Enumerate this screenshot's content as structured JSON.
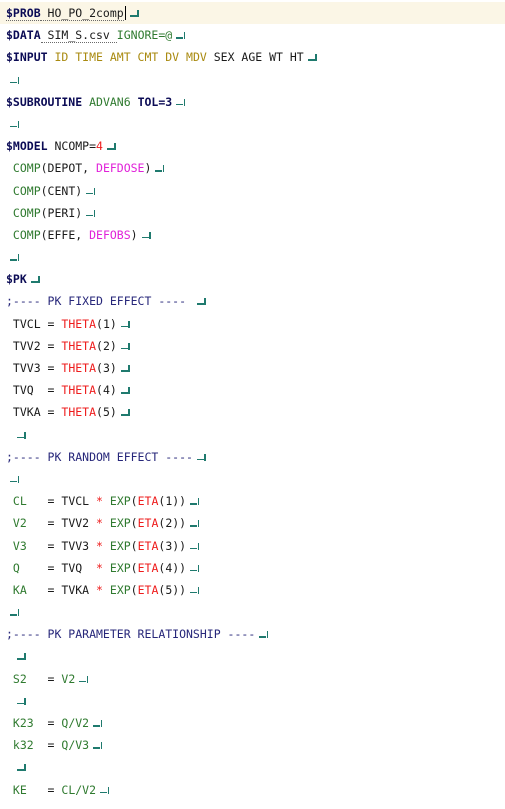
{
  "editor": {
    "lines": [
      [
        [
          "$PROB",
          "kw"
        ],
        [
          " HO_PO_2comp",
          "plain"
        ]
      ],
      [
        [
          "$DATA",
          "kw"
        ],
        [
          " SIM_S.csv ",
          "plain"
        ],
        [
          "IGNORE=@",
          "green"
        ]
      ],
      [
        [
          "$INPUT",
          "kw"
        ],
        [
          " ID TIME AMT CMT DV MDV",
          "olive"
        ],
        [
          " SEX AGE WT HT",
          "plain"
        ]
      ],
      [],
      [
        [
          "$SUBROUTINE",
          "kw"
        ],
        [
          " ADVAN6 ",
          "green"
        ],
        [
          "TOL=3",
          "kw"
        ]
      ],
      [],
      [
        [
          "$MODEL",
          "kw"
        ],
        [
          " NCOMP=",
          "plain"
        ],
        [
          "4",
          "red"
        ]
      ],
      [
        [
          " COMP",
          "green"
        ],
        [
          "(DEPOT, ",
          "plain"
        ],
        [
          "DEFDOSE",
          "mag"
        ],
        [
          ")",
          "plain"
        ]
      ],
      [
        [
          " COMP",
          "green"
        ],
        [
          "(CENT)",
          "plain"
        ]
      ],
      [
        [
          " COMP",
          "green"
        ],
        [
          "(PERI)",
          "plain"
        ]
      ],
      [
        [
          " COMP",
          "green"
        ],
        [
          "(EFFE, ",
          "plain"
        ],
        [
          "DEFOBS",
          "mag"
        ],
        [
          ")",
          "plain"
        ]
      ],
      [],
      [
        [
          "$PK",
          "kw"
        ]
      ],
      [
        [
          ";---- PK FIXED EFFECT ---- ",
          "cmt"
        ]
      ],
      [
        [
          " TVCL = ",
          "plain"
        ],
        [
          "THETA",
          "red"
        ],
        [
          "(1)",
          "plain"
        ]
      ],
      [
        [
          " TVV2 = ",
          "plain"
        ],
        [
          "THETA",
          "red"
        ],
        [
          "(2)",
          "plain"
        ]
      ],
      [
        [
          " TVV3 = ",
          "plain"
        ],
        [
          "THETA",
          "red"
        ],
        [
          "(3)",
          "plain"
        ]
      ],
      [
        [
          " TVQ  = ",
          "plain"
        ],
        [
          "THETA",
          "red"
        ],
        [
          "(4)",
          "plain"
        ]
      ],
      [
        [
          " TVKA = ",
          "plain"
        ],
        [
          "THETA",
          "red"
        ],
        [
          "(5)",
          "plain"
        ]
      ],
      [
        [
          " ",
          "plain"
        ]
      ],
      [
        [
          ";---- PK RANDOM EFFECT ----",
          "cmt"
        ]
      ],
      [],
      [
        [
          " CL",
          "green"
        ],
        [
          "   = TVCL ",
          "plain"
        ],
        [
          "*",
          "red"
        ],
        [
          " EXP",
          "green"
        ],
        [
          "(",
          "plain"
        ],
        [
          "ETA",
          "red"
        ],
        [
          "(1))",
          "plain"
        ]
      ],
      [
        [
          " V2",
          "green"
        ],
        [
          "   = TVV2 ",
          "plain"
        ],
        [
          "*",
          "red"
        ],
        [
          " EXP",
          "green"
        ],
        [
          "(",
          "plain"
        ],
        [
          "ETA",
          "red"
        ],
        [
          "(2))",
          "plain"
        ]
      ],
      [
        [
          " V3",
          "green"
        ],
        [
          "   = TVV3 ",
          "plain"
        ],
        [
          "*",
          "red"
        ],
        [
          " EXP",
          "green"
        ],
        [
          "(",
          "plain"
        ],
        [
          "ETA",
          "red"
        ],
        [
          "(3))",
          "plain"
        ]
      ],
      [
        [
          " Q",
          "green"
        ],
        [
          "    = TVQ  ",
          "plain"
        ],
        [
          "*",
          "red"
        ],
        [
          " EXP",
          "green"
        ],
        [
          "(",
          "plain"
        ],
        [
          "ETA",
          "red"
        ],
        [
          "(4))",
          "plain"
        ]
      ],
      [
        [
          " KA",
          "green"
        ],
        [
          "   = TVKA ",
          "plain"
        ],
        [
          "*",
          "red"
        ],
        [
          " EXP",
          "green"
        ],
        [
          "(",
          "plain"
        ],
        [
          "ETA",
          "red"
        ],
        [
          "(5))",
          "plain"
        ]
      ],
      [],
      [
        [
          ";---- PK PARAMETER RELATIONSHIP ----",
          "cmt"
        ]
      ],
      [
        [
          " ",
          "plain"
        ]
      ],
      [
        [
          " S2",
          "green"
        ],
        [
          "   = ",
          "plain"
        ],
        [
          "V2",
          "green"
        ]
      ],
      [
        [
          " ",
          "plain"
        ]
      ],
      [
        [
          " K23",
          "green"
        ],
        [
          "  = ",
          "plain"
        ],
        [
          "Q/V2",
          "green"
        ]
      ],
      [
        [
          " k32",
          "green"
        ],
        [
          "  = ",
          "plain"
        ],
        [
          "Q/V3",
          "green"
        ]
      ],
      [
        [
          " ",
          "plain"
        ]
      ],
      [
        [
          " KE",
          "green"
        ],
        [
          "   = ",
          "plain"
        ],
        [
          "CL/V2",
          "green"
        ]
      ]
    ]
  }
}
